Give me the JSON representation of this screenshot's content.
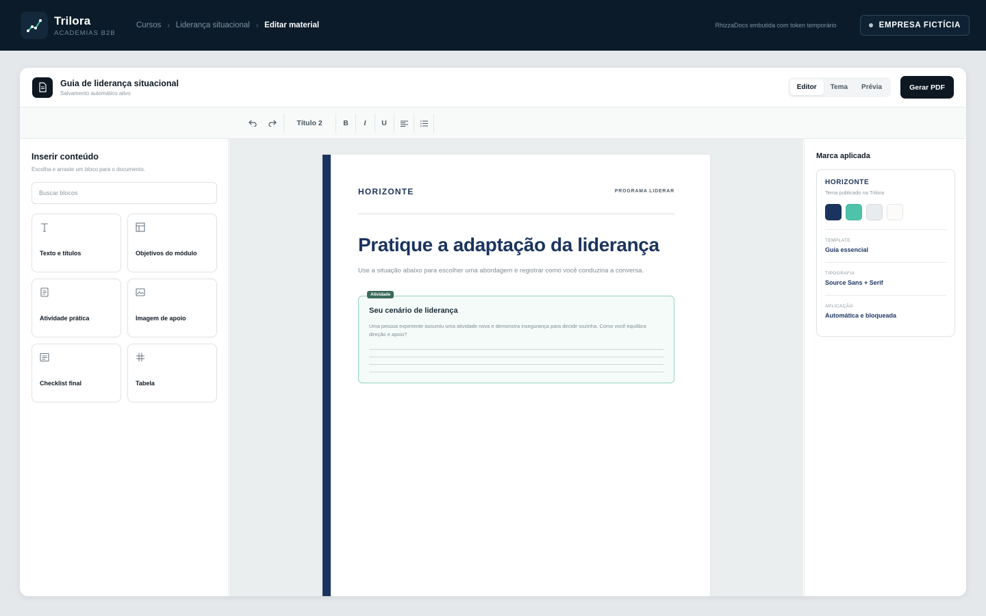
{
  "topbar": {
    "brand_name": "Trilora",
    "brand_sub": "ACADEMIAS B2B",
    "breadcrumbs": [
      "Cursos",
      "Liderança situacional",
      "Editar material"
    ],
    "embed_note": "RhizzaDocs embutida com token temporário",
    "company_label": "EMPRESA FICTÍCIA"
  },
  "header": {
    "doc_title": "Guia de liderança situacional",
    "doc_status": "Salvamento automático ativo",
    "tabs": [
      "Editor",
      "Tema",
      "Prévia"
    ],
    "active_tab": "Editor",
    "generate_pdf": "Gerar PDF"
  },
  "toolbar": {
    "heading_style": "Título 2",
    "bold": "B",
    "italic": "I",
    "underline": "U"
  },
  "insert_panel": {
    "title": "Inserir conteúdo",
    "hint": "Escolha e arraste um bloco para o documento.",
    "search_placeholder": "Buscar blocos",
    "blocks": [
      {
        "label": "Texto e títulos",
        "icon": "text-icon"
      },
      {
        "label": "Objetivos do módulo",
        "icon": "layout-icon"
      },
      {
        "label": "Atividade prática",
        "icon": "document-icon"
      },
      {
        "label": "Imagem de apoio",
        "icon": "image-icon"
      },
      {
        "label": "Checklist final",
        "icon": "checklist-icon"
      },
      {
        "label": "Tabela",
        "icon": "hash-icon"
      }
    ]
  },
  "page": {
    "brand": "HORIZONTE",
    "program": "PROGRAMA LIDERAR",
    "title": "Pratique a adaptação da liderança",
    "lede": "Use a situação abaixo para escolher uma abordagem e registrar como você conduziria a conversa.",
    "activity": {
      "tag": "Atividade",
      "title": "Seu cenário de liderança",
      "text": "Uma pessoa experiente assumiu uma atividade nova e demonstra insegurança para decidir sozinha. Como você equilibra direção e apoio?"
    }
  },
  "brand_panel": {
    "title": "Marca aplicada",
    "theme_name": "HORIZONTE",
    "theme_sub": "Tema publicado na Trilora",
    "swatches": [
      "#1b345f",
      "#4ec3aa",
      "#e9ecef",
      "#fbfbfa"
    ],
    "rows": [
      {
        "key": "TEMPLATE",
        "value": "Guia essencial"
      },
      {
        "key": "TIPOGRAFIA",
        "value": "Source Sans + Serif"
      },
      {
        "key": "APLICAÇÃO",
        "value": "Automática e bloqueada"
      }
    ]
  }
}
